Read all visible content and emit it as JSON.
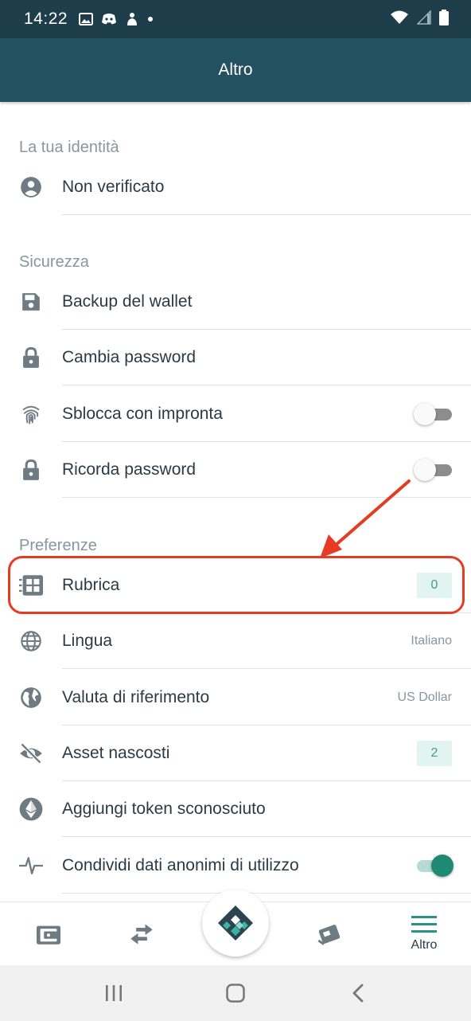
{
  "status_bar": {
    "time": "14:22"
  },
  "app_bar": {
    "title": "Altro"
  },
  "sections": {
    "identity": {
      "header": "La tua identità",
      "items": [
        {
          "label": "Non verificato",
          "icon": "account-circle-icon"
        }
      ]
    },
    "security": {
      "header": "Sicurezza",
      "items": [
        {
          "label": "Backup del wallet",
          "icon": "save-icon"
        },
        {
          "label": "Cambia password",
          "icon": "lock-icon"
        },
        {
          "label": "Sblocca con impronta",
          "icon": "fingerprint-icon",
          "toggle": false
        },
        {
          "label": "Ricorda password",
          "icon": "lock-icon",
          "toggle": false
        }
      ]
    },
    "preferences": {
      "header": "Preferenze",
      "items": [
        {
          "label": "Rubrica",
          "icon": "contacts-icon",
          "badge": "0",
          "highlighted": true
        },
        {
          "label": "Lingua",
          "icon": "globe-icon",
          "value": "Italiano"
        },
        {
          "label": "Valuta di riferimento",
          "icon": "earth-icon",
          "value": "US Dollar"
        },
        {
          "label": "Asset nascosti",
          "icon": "eye-off-icon",
          "badge": "2"
        },
        {
          "label": "Aggiungi token sconosciuto",
          "icon": "ethereum-icon"
        },
        {
          "label": "Condividi dati anonimi di utilizzo",
          "icon": "activity-icon",
          "toggle": true
        }
      ]
    }
  },
  "bottom_nav": {
    "items": [
      {
        "icon": "wallet-icon"
      },
      {
        "icon": "swap-icon"
      },
      {
        "icon": "logo-icon"
      },
      {
        "icon": "cards-icon"
      },
      {
        "icon": "menu-icon",
        "label": "Altro"
      }
    ]
  },
  "colors": {
    "status_bar": "#1e3d4a",
    "app_bar": "#24515f",
    "accent": "#1f8a74",
    "badge_bg": "#e2f4f1",
    "annotation": "#e63b22"
  }
}
